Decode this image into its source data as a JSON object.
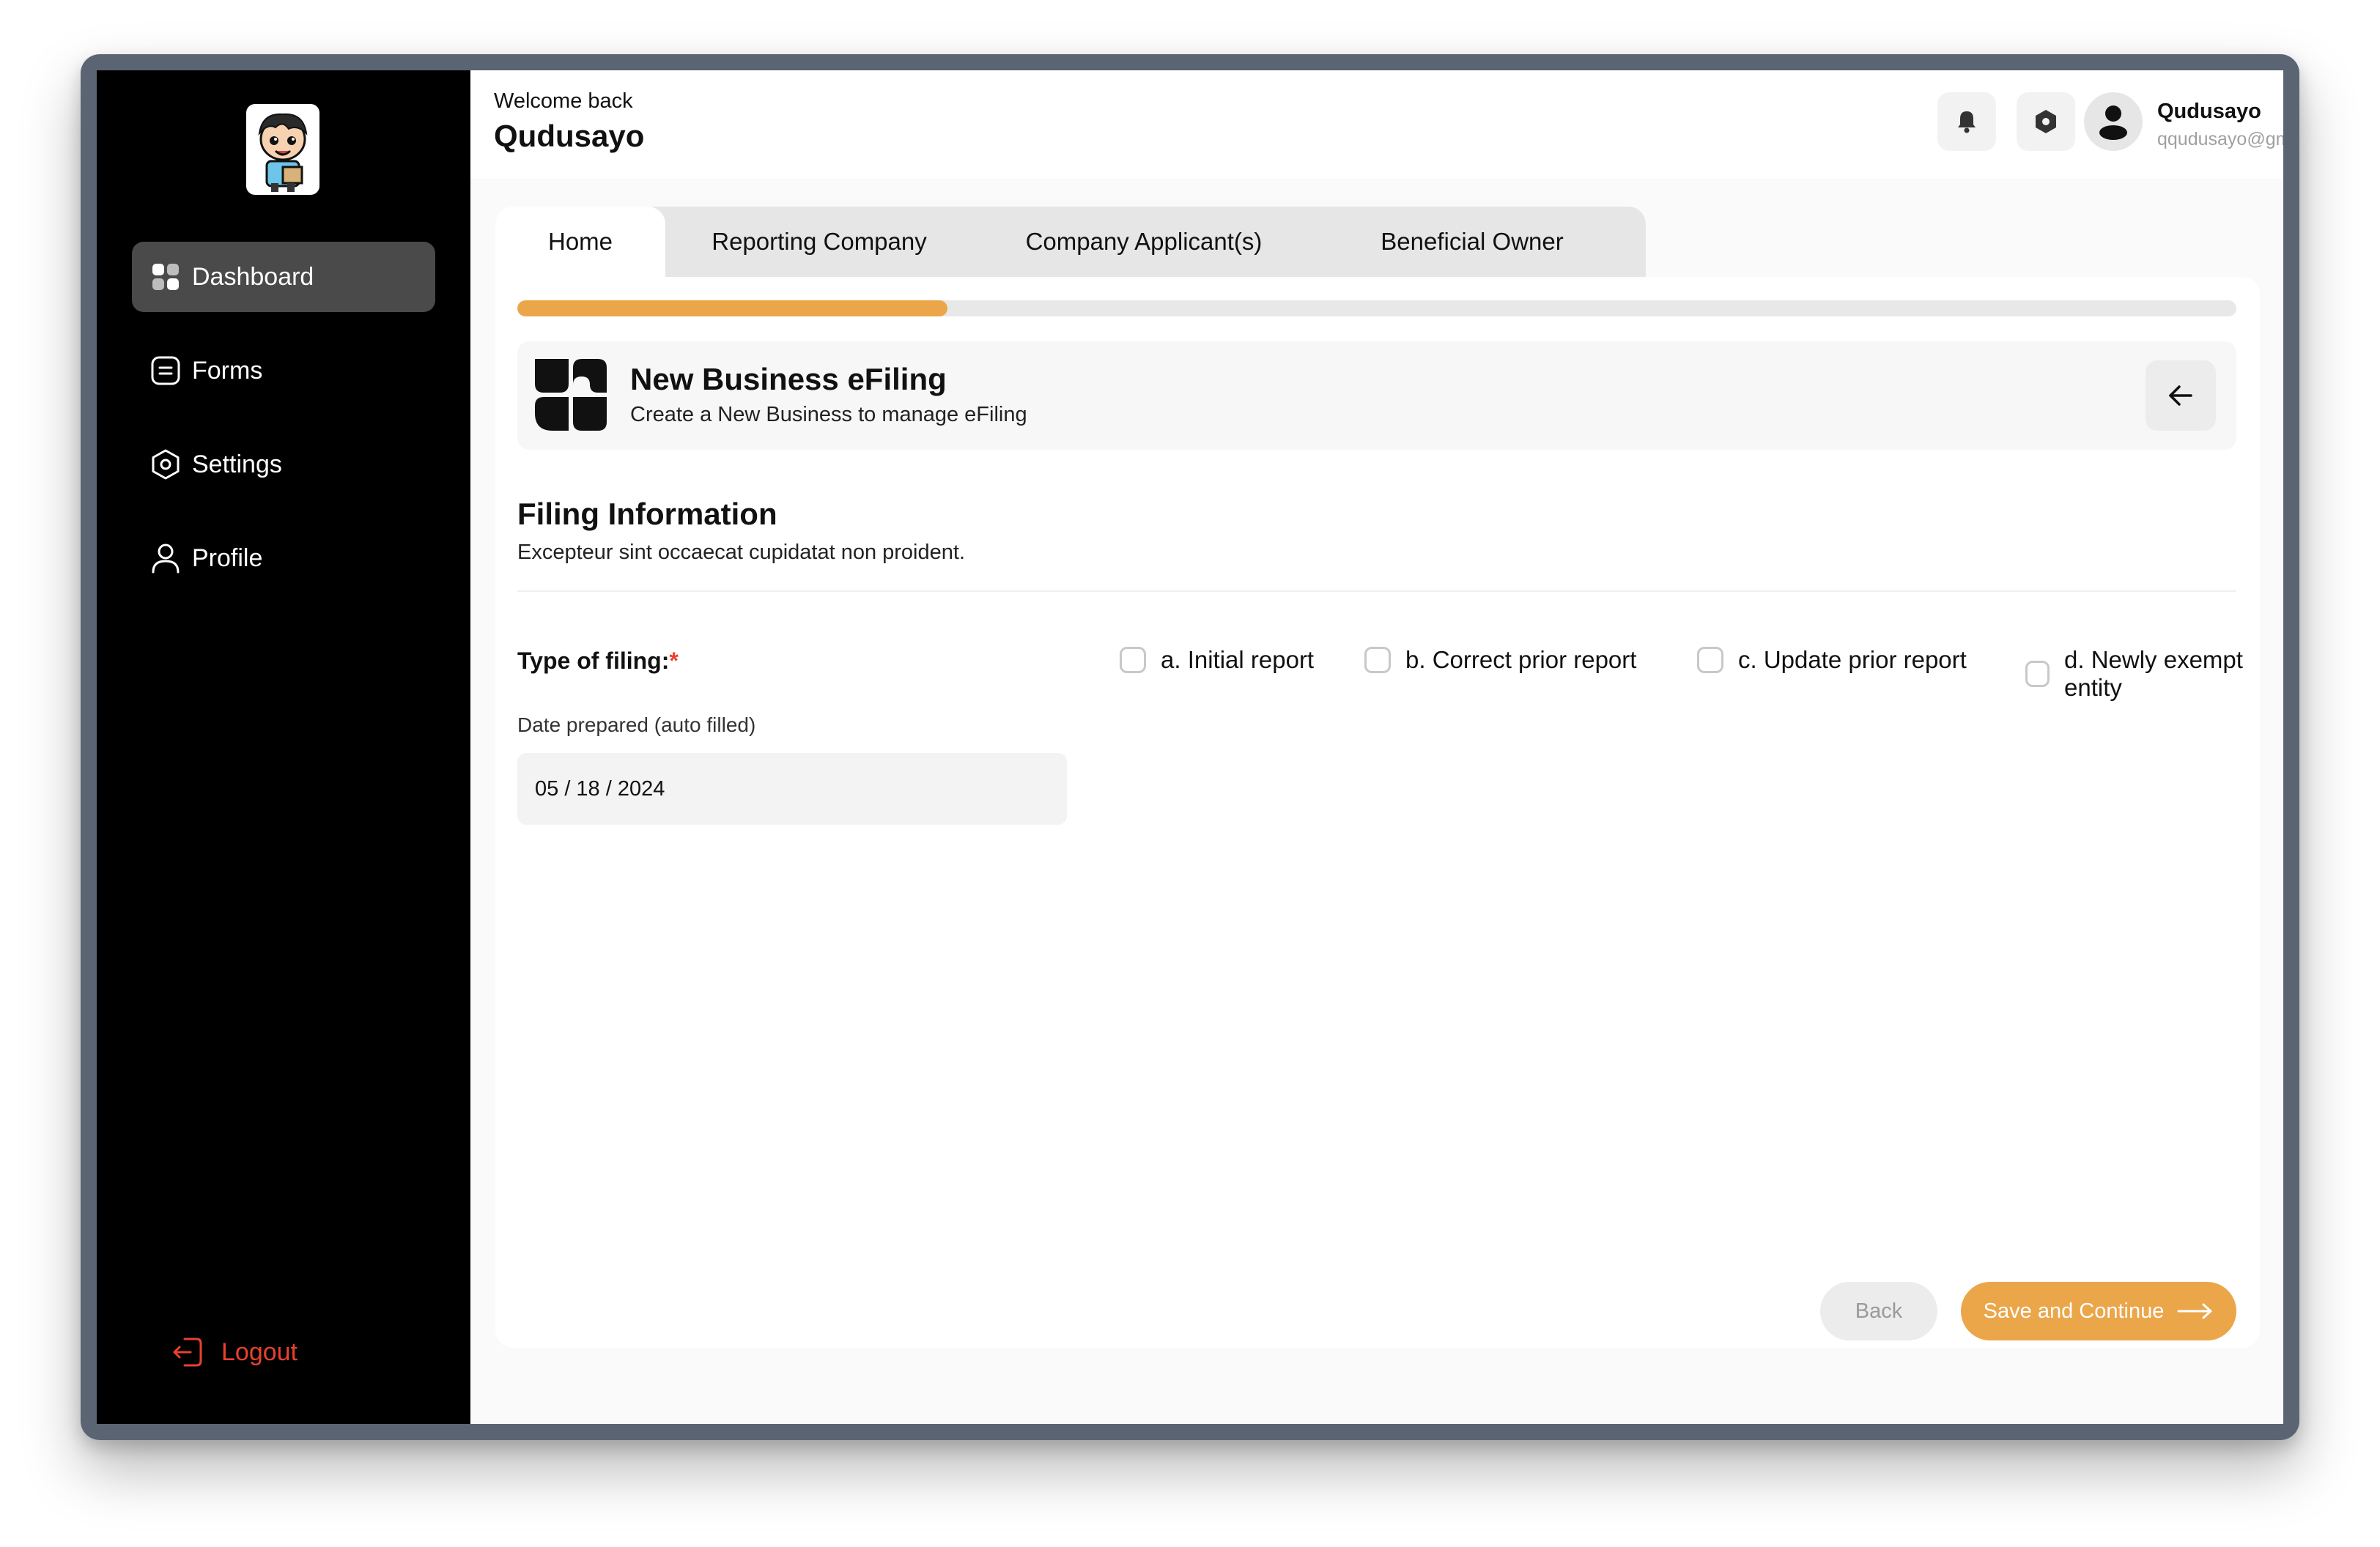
{
  "sidebar": {
    "items": [
      {
        "label": "Dashboard",
        "icon": "dashboard-icon",
        "active": true
      },
      {
        "label": "Forms",
        "icon": "forms-icon",
        "active": false
      },
      {
        "label": "Settings",
        "icon": "settings-icon",
        "active": false
      },
      {
        "label": "Profile",
        "icon": "profile-icon",
        "active": false
      }
    ],
    "logout_label": "Logout"
  },
  "header": {
    "welcome": "Welcome back",
    "username": "Qudusayo",
    "user": {
      "name": "Qudusayo",
      "email": "qqudusayo@gmail.com"
    }
  },
  "tabs": [
    {
      "label": "Home",
      "active": true
    },
    {
      "label": "Reporting Company",
      "active": false
    },
    {
      "label": "Company Applicant(s)",
      "active": false
    },
    {
      "label": "Beneficial Owner",
      "active": false
    }
  ],
  "progress": {
    "fraction": 0.25
  },
  "banner": {
    "title": "New Business eFiling",
    "subtitle": "Create a New Business to manage eFiling"
  },
  "section": {
    "title": "Filing Information",
    "subtitle": "Excepteur sint occaecat cupidatat non proident."
  },
  "filing": {
    "label": "Type of filing:",
    "required_mark": "*",
    "options": [
      {
        "label": "a. Initial report",
        "checked": false
      },
      {
        "label": "b. Correct prior report",
        "checked": false
      },
      {
        "label": "c. Update prior report",
        "checked": false
      },
      {
        "label": "d. Newly exempt entity",
        "checked": false
      }
    ]
  },
  "date": {
    "label": "Date prepared (auto filled)",
    "value": "05 / 18 / 2024"
  },
  "actions": {
    "back_label": "Back",
    "save_label": "Save and Continue"
  },
  "colors": {
    "accent": "#eba64a",
    "danger": "#e8412f",
    "sidebar_bg": "#000000",
    "sidebar_active": "#4a4a4a"
  }
}
